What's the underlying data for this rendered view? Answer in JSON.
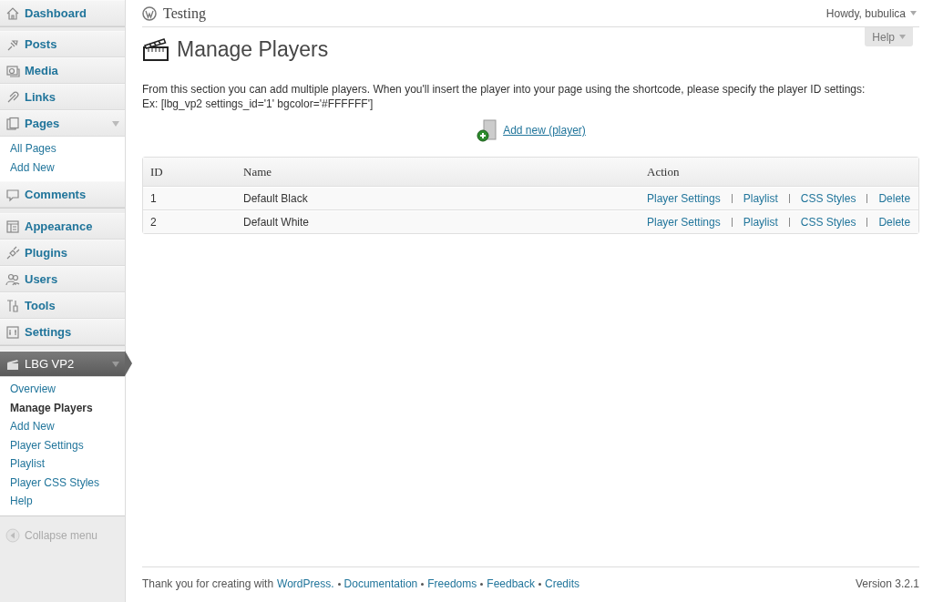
{
  "header": {
    "site_title": "Testing",
    "user_greeting": "Howdy, bubulica"
  },
  "sidebar": {
    "groups": [
      [
        {
          "label": "Dashboard",
          "current": false
        }
      ],
      [
        {
          "label": "Posts",
          "current": false
        },
        {
          "label": "Media",
          "current": false
        },
        {
          "label": "Links",
          "current": false
        },
        {
          "label": "Pages",
          "current": false,
          "expanded": true,
          "submenu": [
            {
              "label": "All Pages",
              "selected": false
            },
            {
              "label": "Add New",
              "selected": false
            }
          ]
        },
        {
          "label": "Comments",
          "current": false
        }
      ],
      [
        {
          "label": "Appearance",
          "current": false
        },
        {
          "label": "Plugins",
          "current": false
        },
        {
          "label": "Users",
          "current": false
        },
        {
          "label": "Tools",
          "current": false
        },
        {
          "label": "Settings",
          "current": false
        }
      ],
      [
        {
          "label": "LBG VP2",
          "current": true,
          "expanded": true,
          "submenu": [
            {
              "label": "Overview",
              "selected": false
            },
            {
              "label": "Manage Players",
              "selected": true
            },
            {
              "label": "Add New",
              "selected": false
            },
            {
              "label": "Player Settings",
              "selected": false
            },
            {
              "label": "Playlist",
              "selected": false
            },
            {
              "label": "Player CSS Styles",
              "selected": false
            },
            {
              "label": "Help",
              "selected": false
            }
          ]
        }
      ]
    ],
    "collapse": "Collapse menu"
  },
  "help_tab": "Help",
  "page": {
    "title": "Manage Players",
    "description": "From this section you can add multiple players. When you'll insert the player into your page using the shortcode, please specify the player ID settings:",
    "example": "Ex: [lbg_vp2 settings_id='1' bgcolor='#FFFFFF']",
    "add_link": "Add new (player)"
  },
  "table": {
    "columns": [
      "ID",
      "Name",
      "Action"
    ],
    "rows": [
      {
        "id": "1",
        "name": "Default Black",
        "actions": [
          "Player Settings",
          "Playlist",
          "CSS Styles",
          "Delete"
        ]
      },
      {
        "id": "2",
        "name": "Default White",
        "actions": [
          "Player Settings",
          "Playlist",
          "CSS Styles",
          "Delete"
        ]
      }
    ]
  },
  "footer": {
    "text": "Thank you for creating with",
    "links": [
      "WordPress.",
      "Documentation",
      "Freedoms",
      "Feedback",
      "Credits"
    ],
    "version": "Version 3.2.1"
  }
}
